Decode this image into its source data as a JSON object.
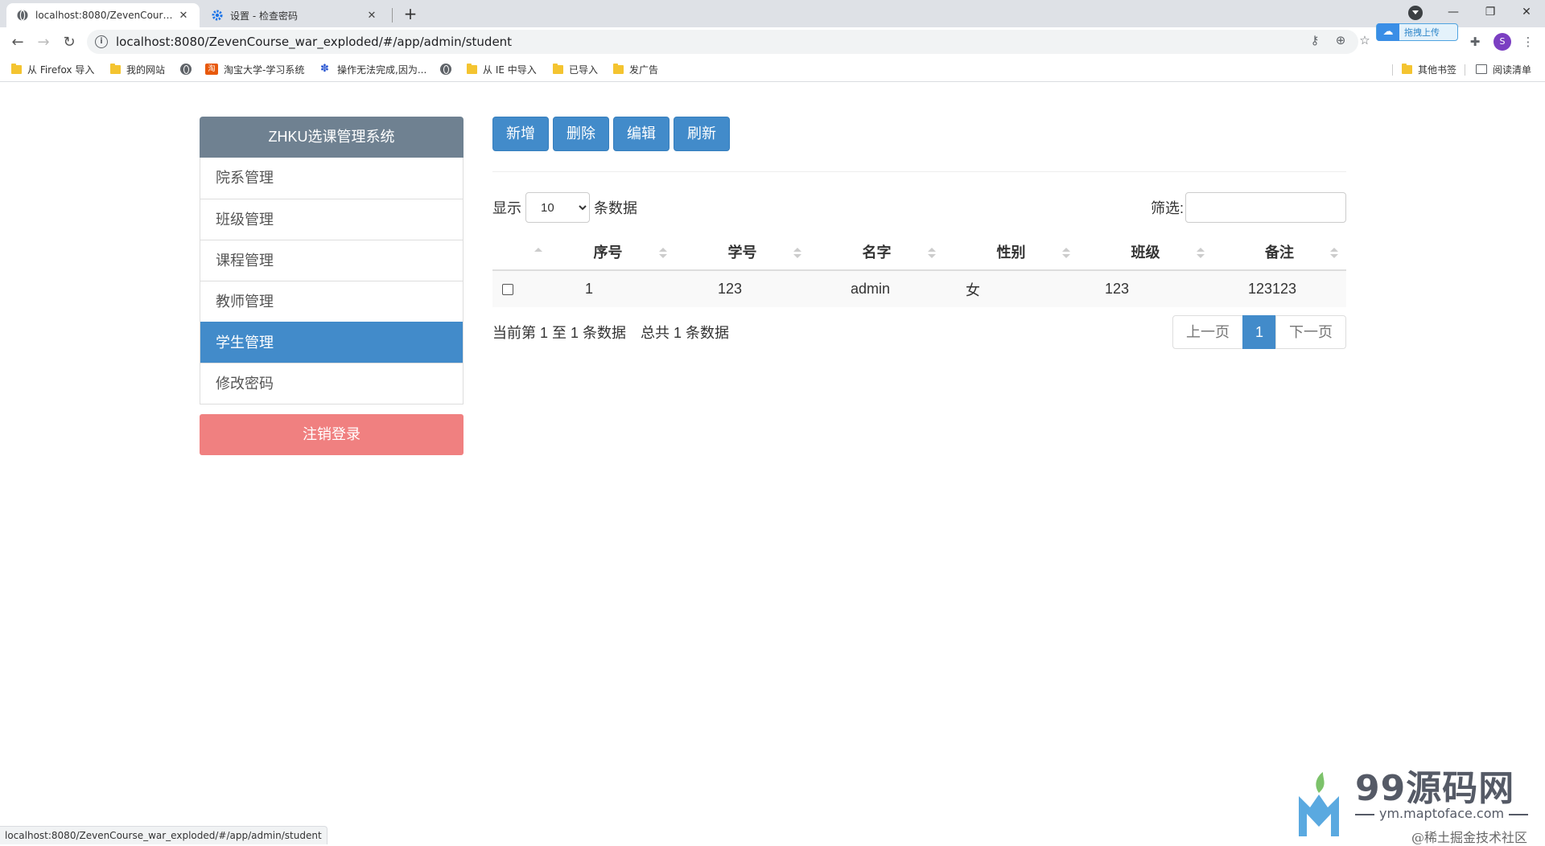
{
  "browser": {
    "tabs": [
      {
        "title": "localhost:8080/ZevenCourse_war_exploded/#/app/admin/student",
        "close": "✕"
      },
      {
        "title": "设置 - 检查密码",
        "close": "✕"
      }
    ],
    "new_tab": "+",
    "window_controls": {
      "minimize": "—",
      "restore": "❐",
      "close": "✕"
    },
    "url": "localhost:8080/ZevenCourse_war_exploded/#/app/admin/student",
    "upload_badge": "拖拽上传",
    "profile_initial": "S",
    "bookmarks": [
      {
        "label": "从 Firefox 导入",
        "icon": "folder-icon"
      },
      {
        "label": "我的网站",
        "icon": "folder-icon"
      },
      {
        "label": "",
        "icon": "globe-icon"
      },
      {
        "label": "淘宝大学-学习系统",
        "icon": "taobao-icon"
      },
      {
        "label": "操作无法完成,因为...",
        "icon": "baidu-paw-icon"
      },
      {
        "label": "",
        "icon": "globe-icon"
      },
      {
        "label": "从 IE 中导入",
        "icon": "folder-icon"
      },
      {
        "label": "已导入",
        "icon": "folder-icon"
      },
      {
        "label": "发广告",
        "icon": "folder-icon"
      }
    ],
    "other_bookmarks": "其他书签",
    "reading_list": "阅读清单",
    "status_url": "localhost:8080/ZevenCourse_war_exploded/#/app/admin/student"
  },
  "sidebar": {
    "title": "ZHKU选课管理系统",
    "items": [
      {
        "label": "院系管理"
      },
      {
        "label": "班级管理"
      },
      {
        "label": "课程管理"
      },
      {
        "label": "教师管理"
      },
      {
        "label": "学生管理",
        "active": true
      },
      {
        "label": "修改密码"
      }
    ],
    "logout": "注销登录"
  },
  "toolbar": {
    "add": "新增",
    "delete": "删除",
    "edit": "编辑",
    "refresh": "刷新"
  },
  "table_controls": {
    "show_prefix": "显示",
    "page_length": "10",
    "page_length_options": [
      "10"
    ],
    "show_suffix": "条数据",
    "filter_label": "筛选:",
    "filter_value": ""
  },
  "table": {
    "columns": [
      "序号",
      "学号",
      "名字",
      "性别",
      "班级",
      "备注"
    ],
    "rows": [
      [
        "1",
        "123",
        "admin",
        "女",
        "123",
        "123123"
      ]
    ]
  },
  "footer": {
    "info": "当前第 1 至 1 条数据　总共 1 条数据",
    "prev": "上一页",
    "current_page": "1",
    "next": "下一页"
  },
  "watermark": {
    "title": "99源码网",
    "url": "ym.maptoface.com",
    "credit": "@稀土掘金技术社区"
  },
  "colors": {
    "primary": "#428bca",
    "sidebar_header": "#6f8191",
    "logout": "#f08080"
  }
}
